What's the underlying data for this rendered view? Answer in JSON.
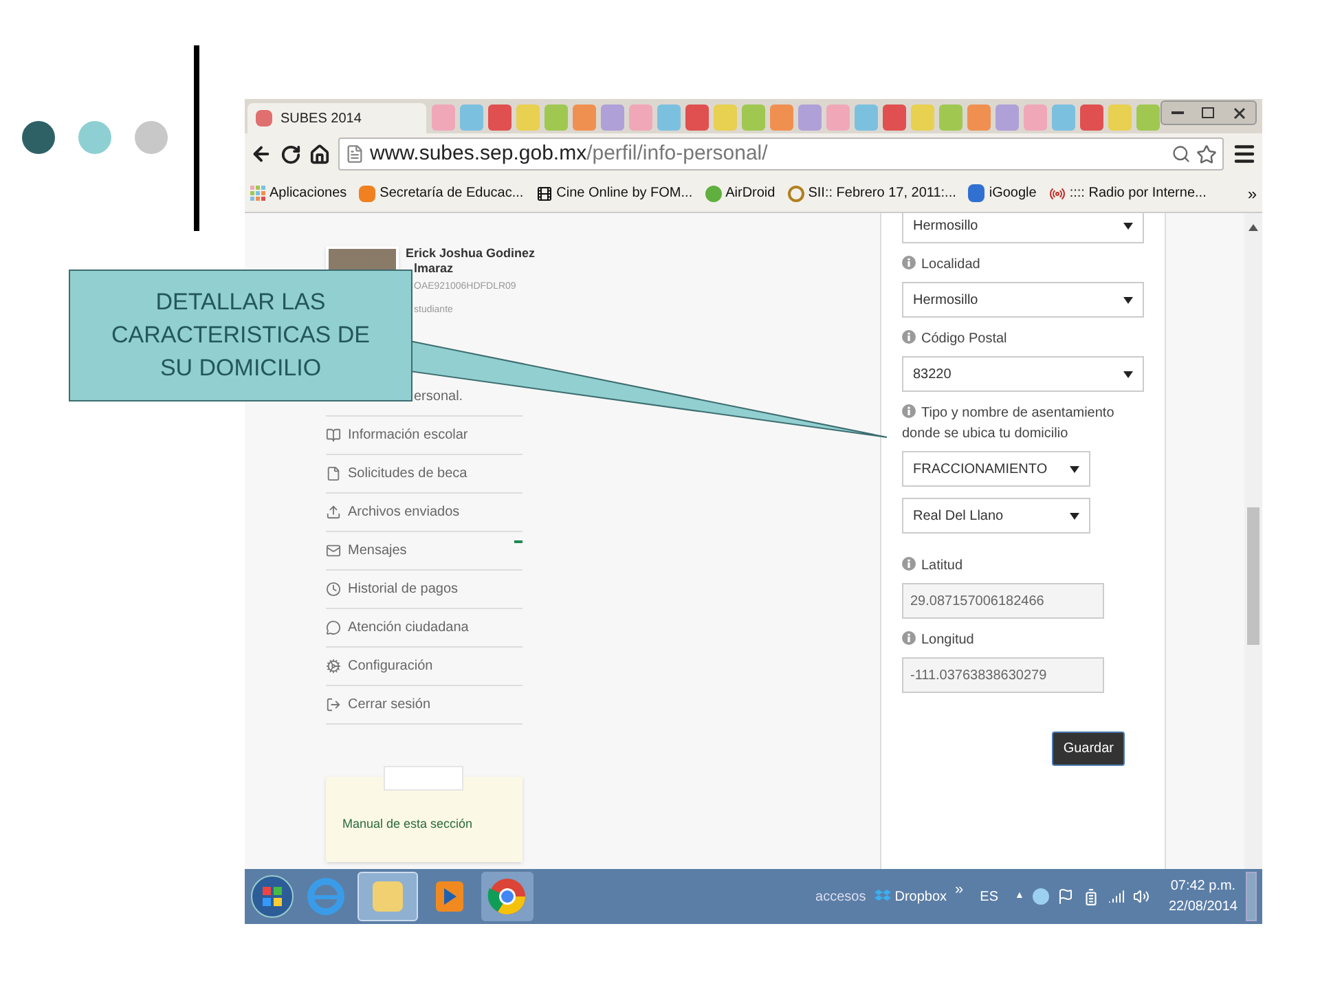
{
  "slide": {
    "callout": "DETALLAR LAS CARACTERISTICAS DE SU DOMICILIO"
  },
  "browser": {
    "tab": {
      "title": "SUBES 2014"
    },
    "url": {
      "host": "www.subes.sep.gob.mx",
      "path": "/perfil/info-personal/"
    },
    "bookmarks": [
      {
        "label": "Aplicaciones"
      },
      {
        "label": "Secretaría de Educac..."
      },
      {
        "label": "Cine Online by FOM..."
      },
      {
        "label": "AirDroid"
      },
      {
        "label": "SII:: Febrero 17, 2011:..."
      },
      {
        "label": "iGoogle"
      },
      {
        "label": ":::: Radio por Interne..."
      }
    ],
    "overflow": "»"
  },
  "profile": {
    "name": "Erick Joshua Godinez",
    "name_rest": "lmaraz",
    "curp": "OAE921006HDFDLR09",
    "role": "studiante"
  },
  "sidebar": {
    "items": [
      {
        "label": "ersonal.",
        "unread": false
      },
      {
        "label": "Información escolar",
        "unread": false
      },
      {
        "label": "Solicitudes de beca",
        "unread": false
      },
      {
        "label": "Archivos enviados",
        "unread": false
      },
      {
        "label": "Mensajes",
        "unread": true
      },
      {
        "label": "Historial de pagos",
        "unread": false
      },
      {
        "label": "Atención ciudadana",
        "unread": false
      },
      {
        "label": "Configuración",
        "unread": false
      },
      {
        "label": "Cerrar sesión",
        "unread": false
      }
    ],
    "manual": "Manual de esta sección"
  },
  "form": {
    "rows": [
      {
        "kind": "select",
        "value": "Hermosillo"
      },
      {
        "kind": "label",
        "text": "Localidad"
      },
      {
        "kind": "select",
        "value": "Hermosillo"
      },
      {
        "kind": "label",
        "text": "Código Postal"
      },
      {
        "kind": "select",
        "value": "83220"
      },
      {
        "kind": "label",
        "text": "Tipo y nombre de asentamiento donde se ubica tu domicilio"
      },
      {
        "kind": "subselect",
        "value": "FRACCIONAMIENTO"
      },
      {
        "kind": "subselect",
        "value": "Real Del Llano"
      },
      {
        "kind": "label",
        "text": "Latitud"
      },
      {
        "kind": "input",
        "value": "29.087157006182466"
      },
      {
        "kind": "label",
        "text": "Longitud"
      },
      {
        "kind": "input",
        "value": "-111.03763838630279"
      }
    ],
    "save": "Guardar"
  },
  "taskbar": {
    "toolbar": "accesos",
    "dropbox": "Dropbox",
    "more": "»",
    "language": "ES",
    "tray_toggle": "▲",
    "time": "07:42 p.m.",
    "date": "22/08/2014"
  }
}
